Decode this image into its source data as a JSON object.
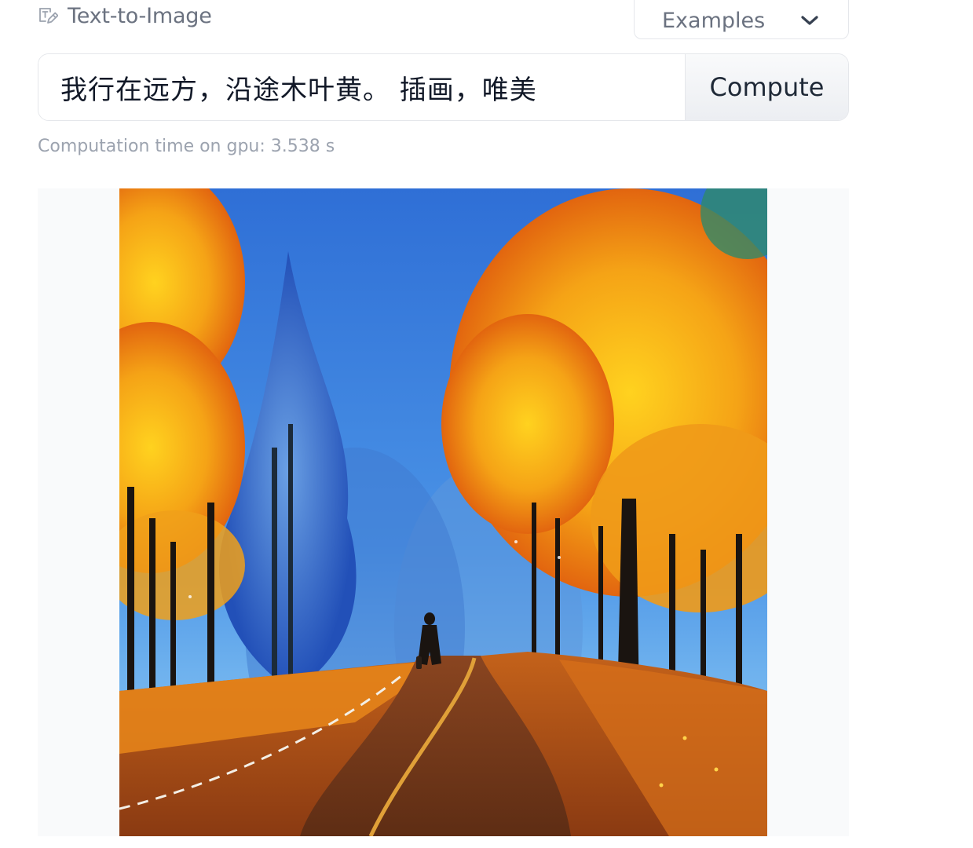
{
  "header": {
    "task_icon": "text-to-image-icon",
    "task_label": "Text-to-Image",
    "examples_label": "Examples",
    "examples_icon": "chevron-down-icon"
  },
  "input": {
    "value": "我行在远方，沿途木叶黄。 插画，唯美",
    "button_label": "Compute"
  },
  "status": {
    "timing_text": "Computation time on gpu: 3.538 s"
  },
  "colors": {
    "border": "#e5e7eb",
    "muted_text": "#9ca3af",
    "label_text": "#6b7280",
    "panel_bg": "#f9fafb"
  }
}
